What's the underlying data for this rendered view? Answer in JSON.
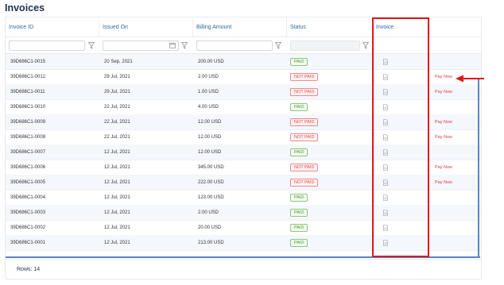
{
  "page": {
    "title": "Invoices"
  },
  "columns": [
    {
      "key": "id",
      "label": "Invoice ID"
    },
    {
      "key": "issued",
      "label": "Issued On"
    },
    {
      "key": "amount",
      "label": "Billing Amount"
    },
    {
      "key": "status",
      "label": "Status"
    },
    {
      "key": "invoice",
      "label": "Invoice"
    }
  ],
  "rows": [
    {
      "id": "39D686C1-0015",
      "issued": "20 Sep, 2021",
      "amount": "200.00 USD",
      "status": "PAID",
      "action": ""
    },
    {
      "id": "39D686C1-0012",
      "issued": "29 Jul, 2021",
      "amount": "2.00 USD",
      "status": "NOT PAID",
      "action": "Pay Now"
    },
    {
      "id": "39D686C1-0011",
      "issued": "29 Jul, 2021",
      "amount": "1.00 USD",
      "status": "NOT PAID",
      "action": "Pay Now"
    },
    {
      "id": "39D686C1-0010",
      "issued": "22 Jul, 2021",
      "amount": "4.00 USD",
      "status": "PAID",
      "action": ""
    },
    {
      "id": "39D686C1-0009",
      "issued": "22 Jul, 2021",
      "amount": "12.00 USD",
      "status": "NOT PAID",
      "action": "Pay Now"
    },
    {
      "id": "39D686C1-0008",
      "issued": "22 Jul, 2021",
      "amount": "12.00 USD",
      "status": "NOT PAID",
      "action": "Pay Now"
    },
    {
      "id": "39D686C1-0007",
      "issued": "12 Jul, 2021",
      "amount": "12.00 USD",
      "status": "PAID",
      "action": ""
    },
    {
      "id": "39D686C1-0006",
      "issued": "12 Jul, 2021",
      "amount": "345.00 USD",
      "status": "NOT PAID",
      "action": "Pay Now"
    },
    {
      "id": "39D686C1-0005",
      "issued": "12 Jul, 2021",
      "amount": "222.00 USD",
      "status": "NOT PAID",
      "action": "Pay Now"
    },
    {
      "id": "39D686C1-0004",
      "issued": "12 Jul, 2021",
      "amount": "123.00 USD",
      "status": "PAID",
      "action": ""
    },
    {
      "id": "39D686C1-0003",
      "issued": "12 Jul, 2021",
      "amount": "2.00 USD",
      "status": "PAID",
      "action": ""
    },
    {
      "id": "39D686C1-0002",
      "issued": "12 Jul, 2021",
      "amount": "20.00 USD",
      "status": "PAID",
      "action": ""
    },
    {
      "id": "39D686C1-0001",
      "issued": "12 Jul, 2021",
      "amount": "213.00 USD",
      "status": "PAID",
      "action": ""
    }
  ],
  "footer": {
    "rows_label": "Rows: 14"
  },
  "icons": {
    "filter": "filter-icon",
    "calendar": "calendar-icon",
    "invoice": "document-icon"
  },
  "colors": {
    "accent": "#2d6aa3",
    "paid": "#4a9a2e",
    "not_paid": "#e04a4a",
    "highlight": "#e0161b"
  }
}
